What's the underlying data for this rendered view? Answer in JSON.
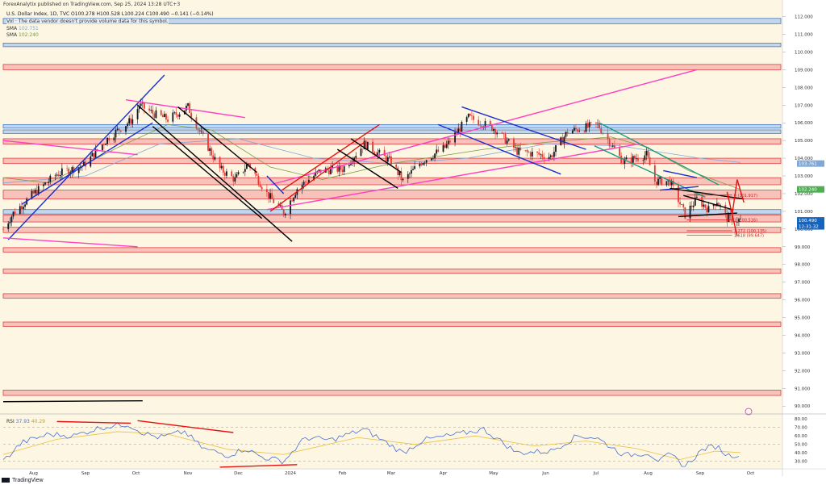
{
  "header": {
    "publisher": "ForexAnalytix published on TradingView.com, Sep 25, 2024 13:28 UTC+3",
    "symbol_line": "U.S. Dollar Index, 1D, TVC  O100.278  H100.528  L100.224  C100.490  −0.141 (−0.14%)",
    "volume_note": "Vol · The data vendor doesn't provide volume data for this symbol.",
    "sma1_label": "SMA",
    "sma1_value": "102.751",
    "sma2_label": "SMA",
    "sma2_value": "102.240"
  },
  "rsi_legend": {
    "label": "RSI",
    "value1": "37.93",
    "value2": "40.29"
  },
  "footer": {
    "brand": "TradingView"
  },
  "colors": {
    "background": "#fdf6e3",
    "candle_up": "#131722",
    "candle_down": "#e53935",
    "zone_red": "#f4b9b2",
    "zone_red_border": "#e04040",
    "zone_blue": "#b7d1ec",
    "zone_blue_border": "#4a78c0",
    "magenta": "#ff40c0",
    "blue_line": "#1a2fd0",
    "black_line": "#000000",
    "red_line": "#e81010",
    "teal_line": "#1a9a80",
    "sma_fast": "#7fa8d8",
    "sma_slow": "#7a9a40",
    "rsi_line": "#4a70d0",
    "rsi_signal": "#e8c040"
  },
  "chart_data": {
    "type": "candlestick",
    "title": "U.S. Dollar Index, 1D, TVC",
    "y_axis": {
      "ticks": [
        "112.000",
        "111.000",
        "110.000",
        "109.000",
        "108.000",
        "107.000",
        "106.000",
        "105.000",
        "104.000",
        "103.000",
        "102.000",
        "101.000",
        "100.000",
        "99.000",
        "98.000",
        "97.000",
        "96.000",
        "95.000",
        "94.000",
        "93.000",
        "92.000",
        "91.000",
        "90.000"
      ],
      "range": [
        89.6,
        112.3
      ]
    },
    "x_axis": {
      "ticks": [
        "Aug",
        "Sep",
        "Oct",
        "Nov",
        "Dec",
        "2024",
        "Feb",
        "Mar",
        "Apr",
        "May",
        "Jun",
        "Jul",
        "Aug",
        "Sep",
        "Oct"
      ]
    },
    "price_labels": [
      {
        "value": 103.7,
        "text": "103.761",
        "color": "#7fa8d8"
      },
      {
        "value": 102.24,
        "text": "102.240",
        "color": "#4caf50"
      },
      {
        "value": 100.49,
        "text": "100.490",
        "color": "#1565c0"
      },
      {
        "value": 100.15,
        "text": "12:31:32",
        "color": "#1565c0"
      }
    ],
    "fib_labels": [
      {
        "value": 101.917,
        "text": "0 (101.917)"
      },
      {
        "value": 100.516,
        "text": "1 (100.516)"
      },
      {
        "value": 99.9,
        "text": "1.272 (100.135)"
      },
      {
        "value": 99.647,
        "text": "1.618 (99.647)"
      }
    ],
    "close_path": [
      {
        "x": "2023-07-14",
        "y": 100.0
      },
      {
        "x": "2023-07-20",
        "y": 100.9
      },
      {
        "x": "2023-08-01",
        "y": 102.0
      },
      {
        "x": "2023-08-15",
        "y": 103.1
      },
      {
        "x": "2023-08-31",
        "y": 103.6
      },
      {
        "x": "2023-09-15",
        "y": 105.2
      },
      {
        "x": "2023-09-29",
        "y": 106.2
      },
      {
        "x": "2023-10-03",
        "y": 107.0
      },
      {
        "x": "2023-10-12",
        "y": 106.5
      },
      {
        "x": "2023-10-20",
        "y": 106.2
      },
      {
        "x": "2023-11-01",
        "y": 106.9
      },
      {
        "x": "2023-11-08",
        "y": 105.5
      },
      {
        "x": "2023-11-20",
        "y": 103.4
      },
      {
        "x": "2023-11-29",
        "y": 102.8
      },
      {
        "x": "2023-12-07",
        "y": 103.7
      },
      {
        "x": "2023-12-18",
        "y": 102.0
      },
      {
        "x": "2023-12-28",
        "y": 100.9
      },
      {
        "x": "2024-01-05",
        "y": 102.3
      },
      {
        "x": "2024-01-19",
        "y": 103.3
      },
      {
        "x": "2024-02-01",
        "y": 103.4
      },
      {
        "x": "2024-02-14",
        "y": 104.8
      },
      {
        "x": "2024-03-01",
        "y": 103.8
      },
      {
        "x": "2024-03-08",
        "y": 102.7
      },
      {
        "x": "2024-03-19",
        "y": 103.8
      },
      {
        "x": "2024-04-02",
        "y": 104.6
      },
      {
        "x": "2024-04-16",
        "y": 106.3
      },
      {
        "x": "2024-05-01",
        "y": 105.7
      },
      {
        "x": "2024-05-15",
        "y": 104.4
      },
      {
        "x": "2024-06-04",
        "y": 104.1
      },
      {
        "x": "2024-06-14",
        "y": 105.5
      },
      {
        "x": "2024-07-02",
        "y": 105.9
      },
      {
        "x": "2024-07-17",
        "y": 103.8
      },
      {
        "x": "2024-07-31",
        "y": 104.2
      },
      {
        "x": "2024-08-05",
        "y": 102.7
      },
      {
        "x": "2024-08-14",
        "y": 102.7
      },
      {
        "x": "2024-08-23",
        "y": 100.8
      },
      {
        "x": "2024-08-30",
        "y": 101.7
      },
      {
        "x": "2024-09-06",
        "y": 101.1
      },
      {
        "x": "2024-09-11",
        "y": 101.6
      },
      {
        "x": "2024-09-17",
        "y": 100.6
      },
      {
        "x": "2024-09-25",
        "y": 100.49
      }
    ],
    "sma_fast_path": [
      {
        "x": "2023-07-14",
        "y": 102.6
      },
      {
        "x": "2023-09-01",
        "y": 103.0
      },
      {
        "x": "2023-10-15",
        "y": 104.8
      },
      {
        "x": "2023-12-01",
        "y": 105.1
      },
      {
        "x": "2024-01-15",
        "y": 104.0
      },
      {
        "x": "2024-03-01",
        "y": 103.7
      },
      {
        "x": "2024-04-15",
        "y": 104.0
      },
      {
        "x": "2024-06-01",
        "y": 104.8
      },
      {
        "x": "2024-07-15",
        "y": 104.7
      },
      {
        "x": "2024-09-01",
        "y": 104.0
      },
      {
        "x": "2024-09-25",
        "y": 103.76
      }
    ],
    "sma_slow_path": [
      {
        "x": "2023-07-14",
        "y": 102.9
      },
      {
        "x": "2023-08-10",
        "y": 102.6
      },
      {
        "x": "2023-09-20",
        "y": 104.6
      },
      {
        "x": "2023-10-20",
        "y": 105.9
      },
      {
        "x": "2023-11-15",
        "y": 105.6
      },
      {
        "x": "2023-12-20",
        "y": 103.5
      },
      {
        "x": "2024-01-20",
        "y": 102.8
      },
      {
        "x": "2024-03-01",
        "y": 103.7
      },
      {
        "x": "2024-04-25",
        "y": 104.5
      },
      {
        "x": "2024-06-01",
        "y": 104.9
      },
      {
        "x": "2024-07-10",
        "y": 105.2
      },
      {
        "x": "2024-08-01",
        "y": 104.6
      },
      {
        "x": "2024-08-25",
        "y": 103.3
      },
      {
        "x": "2024-09-25",
        "y": 102.24
      }
    ],
    "zones": [
      {
        "color": "blue",
        "from": 111.6,
        "to": 111.9
      },
      {
        "color": "blue",
        "from": 110.3,
        "to": 110.5
      },
      {
        "color": "red",
        "from": 109.0,
        "to": 109.3
      },
      {
        "color": "blue",
        "from": 105.7,
        "to": 105.9
      },
      {
        "color": "blue",
        "from": 105.4,
        "to": 105.6
      },
      {
        "color": "red",
        "from": 104.8,
        "to": 105.1
      },
      {
        "color": "red",
        "from": 103.7,
        "to": 104.0
      },
      {
        "color": "red",
        "from": 102.5,
        "to": 102.9
      },
      {
        "color": "red",
        "from": 101.7,
        "to": 102.2
      },
      {
        "color": "blue",
        "from": 100.85,
        "to": 101.1
      },
      {
        "color": "red",
        "from": 100.4,
        "to": 100.8
      },
      {
        "color": "red",
        "from": 99.8,
        "to": 100.1
      },
      {
        "color": "red",
        "from": 98.7,
        "to": 98.95
      },
      {
        "color": "red",
        "from": 97.5,
        "to": 97.75
      },
      {
        "color": "red",
        "from": 96.1,
        "to": 96.35
      },
      {
        "color": "red",
        "from": 94.5,
        "to": 94.75
      },
      {
        "color": "red",
        "from": 90.6,
        "to": 90.9
      }
    ],
    "trendlines": [
      {
        "color": "blue",
        "from": {
          "x": "2023-07-17",
          "y": 99.4
        },
        "to": {
          "x": "2023-10-18",
          "y": 108.7
        }
      },
      {
        "color": "blue",
        "from": {
          "x": "2023-07-25",
          "y": 101.4
        },
        "to": {
          "x": "2023-10-11",
          "y": 106.0
        }
      },
      {
        "color": "magenta",
        "from": {
          "x": "2023-07-14",
          "y": 105.0
        },
        "to": {
          "x": "2023-10-02",
          "y": 104.2
        }
      },
      {
        "color": "magenta",
        "from": {
          "x": "2023-07-14",
          "y": 99.5
        },
        "to": {
          "x": "2023-10-02",
          "y": 99.0
        }
      },
      {
        "color": "magenta",
        "from": {
          "x": "2023-09-25",
          "y": 107.3
        },
        "to": {
          "x": "2023-12-05",
          "y": 106.3
        }
      },
      {
        "color": "black",
        "from": {
          "x": "2023-10-02",
          "y": 107.0
        },
        "to": {
          "x": "2024-01-02",
          "y": 99.3
        }
      },
      {
        "color": "black",
        "from": {
          "x": "2023-10-11",
          "y": 105.8
        },
        "to": {
          "x": "2023-12-15",
          "y": 100.6
        }
      },
      {
        "color": "black",
        "from": {
          "x": "2023-10-26",
          "y": 106.9
        },
        "to": {
          "x": "2023-12-12",
          "y": 103.2
        }
      },
      {
        "color": "magenta",
        "from": {
          "x": "2023-12-18",
          "y": 101.1
        },
        "to": {
          "x": "2024-07-26",
          "y": 104.8
        }
      },
      {
        "color": "magenta",
        "from": {
          "x": "2023-12-20",
          "y": 102.5
        },
        "to": {
          "x": "2024-08-30",
          "y": 109.0
        }
      },
      {
        "color": "blue",
        "from": {
          "x": "2023-12-18",
          "y": 103.0
        },
        "to": {
          "x": "2023-12-28",
          "y": 102.0
        }
      },
      {
        "color": "red",
        "from": {
          "x": "2023-12-20",
          "y": 101.0
        },
        "to": {
          "x": "2024-02-14",
          "y": 104.9
        }
      },
      {
        "color": "red",
        "from": {
          "x": "2023-12-27",
          "y": 102.2
        },
        "to": {
          "x": "2024-02-23",
          "y": 105.9
        }
      },
      {
        "color": "black",
        "from": {
          "x": "2024-01-29",
          "y": 104.5
        },
        "to": {
          "x": "2024-03-05",
          "y": 102.3
        }
      },
      {
        "color": "black",
        "from": {
          "x": "2024-02-06",
          "y": 105.1
        },
        "to": {
          "x": "2024-03-07",
          "y": 103.2
        }
      },
      {
        "color": "blue",
        "from": {
          "x": "2024-03-29",
          "y": 105.9
        },
        "to": {
          "x": "2024-06-10",
          "y": 103.1
        }
      },
      {
        "color": "blue",
        "from": {
          "x": "2024-04-12",
          "y": 106.9
        },
        "to": {
          "x": "2024-06-25",
          "y": 104.5
        }
      },
      {
        "color": "teal",
        "from": {
          "x": "2024-07-03",
          "y": 106.0
        },
        "to": {
          "x": "2024-09-12",
          "y": 102.5
        }
      },
      {
        "color": "teal",
        "from": {
          "x": "2024-06-30",
          "y": 104.7
        },
        "to": {
          "x": "2024-09-04",
          "y": 101.8
        }
      },
      {
        "color": "blue",
        "from": {
          "x": "2024-08-08",
          "y": 102.2
        },
        "to": {
          "x": "2024-08-31",
          "y": 102.4
        }
      },
      {
        "color": "blue",
        "from": {
          "x": "2024-08-10",
          "y": 103.3
        },
        "to": {
          "x": "2024-08-30",
          "y": 102.9
        }
      },
      {
        "color": "black",
        "from": {
          "x": "2024-08-14",
          "y": 102.3
        },
        "to": {
          "x": "2024-09-27",
          "y": 101.7
        }
      },
      {
        "color": "black",
        "from": {
          "x": "2024-08-19",
          "y": 100.7
        },
        "to": {
          "x": "2024-09-23",
          "y": 100.9
        }
      },
      {
        "color": "black",
        "from": {
          "x": "2024-08-22",
          "y": 101.9
        },
        "to": {
          "x": "2024-09-20",
          "y": 101.1
        }
      },
      {
        "color": "red",
        "from": {
          "x": "2024-09-20",
          "y": 100.8
        },
        "to": {
          "x": "2024-09-23",
          "y": 102.8
        }
      },
      {
        "color": "red",
        "from": {
          "x": "2024-09-23",
          "y": 102.8
        },
        "to": {
          "x": "2024-09-27",
          "y": 101.5
        }
      },
      {
        "color": "red",
        "from": {
          "x": "2024-09-17",
          "y": 102.1
        },
        "to": {
          "x": "2024-09-23",
          "y": 99.6
        }
      }
    ],
    "rsi": {
      "ticks": [
        "80.00",
        "70.00",
        "60.00",
        "50.00",
        "40.00",
        "30.00"
      ],
      "range": [
        22,
        85
      ],
      "series": [
        {
          "x": "2023-07-14",
          "y": 30
        },
        {
          "x": "2023-07-25",
          "y": 52
        },
        {
          "x": "2023-08-10",
          "y": 62
        },
        {
          "x": "2023-08-25",
          "y": 60
        },
        {
          "x": "2023-09-10",
          "y": 70
        },
        {
          "x": "2023-09-26",
          "y": 74
        },
        {
          "x": "2023-10-06",
          "y": 63
        },
        {
          "x": "2023-10-15",
          "y": 58
        },
        {
          "x": "2023-10-30",
          "y": 65
        },
        {
          "x": "2023-11-10",
          "y": 45
        },
        {
          "x": "2023-11-25",
          "y": 37
        },
        {
          "x": "2023-12-05",
          "y": 45
        },
        {
          "x": "2023-12-15",
          "y": 35
        },
        {
          "x": "2023-12-28",
          "y": 30
        },
        {
          "x": "2024-01-10",
          "y": 58
        },
        {
          "x": "2024-01-25",
          "y": 55
        },
        {
          "x": "2024-02-14",
          "y": 68
        },
        {
          "x": "2024-03-08",
          "y": 40
        },
        {
          "x": "2024-03-20",
          "y": 55
        },
        {
          "x": "2024-04-10",
          "y": 62
        },
        {
          "x": "2024-04-25",
          "y": 68
        },
        {
          "x": "2024-05-15",
          "y": 40
        },
        {
          "x": "2024-06-04",
          "y": 42
        },
        {
          "x": "2024-06-20",
          "y": 60
        },
        {
          "x": "2024-07-01",
          "y": 58
        },
        {
          "x": "2024-07-18",
          "y": 37
        },
        {
          "x": "2024-08-01",
          "y": 40
        },
        {
          "x": "2024-08-08",
          "y": 30
        },
        {
          "x": "2024-08-14",
          "y": 38
        },
        {
          "x": "2024-08-23",
          "y": 24
        },
        {
          "x": "2024-09-03",
          "y": 45
        },
        {
          "x": "2024-09-11",
          "y": 48
        },
        {
          "x": "2024-09-17",
          "y": 37
        },
        {
          "x": "2024-09-25",
          "y": 37.93
        }
      ],
      "signal": [
        {
          "x": "2023-07-14",
          "y": 38
        },
        {
          "x": "2023-08-15",
          "y": 56
        },
        {
          "x": "2023-09-20",
          "y": 65
        },
        {
          "x": "2023-10-20",
          "y": 62
        },
        {
          "x": "2023-11-25",
          "y": 44
        },
        {
          "x": "2023-12-28",
          "y": 38
        },
        {
          "x": "2024-02-10",
          "y": 58
        },
        {
          "x": "2024-03-15",
          "y": 50
        },
        {
          "x": "2024-04-20",
          "y": 60
        },
        {
          "x": "2024-05-25",
          "y": 48
        },
        {
          "x": "2024-06-25",
          "y": 54
        },
        {
          "x": "2024-07-25",
          "y": 45
        },
        {
          "x": "2024-08-20",
          "y": 32
        },
        {
          "x": "2024-09-10",
          "y": 42
        },
        {
          "x": "2024-09-25",
          "y": 40.29
        }
      ],
      "lines": [
        {
          "color": "red",
          "from": {
            "x": "2023-08-15",
            "y": 77
          },
          "to": {
            "x": "2023-09-28",
            "y": 75
          }
        },
        {
          "color": "red",
          "from": {
            "x": "2023-10-02",
            "y": 78
          },
          "to": {
            "x": "2023-11-28",
            "y": 64
          }
        },
        {
          "color": "red",
          "from": {
            "x": "2023-11-20",
            "y": 23
          },
          "to": {
            "x": "2024-01-05",
            "y": 26
          }
        },
        {
          "color": "black",
          "from": {
            "x": "2023-07-14",
            "y": 85
          },
          "to": {
            "x": "2023-10-05",
            "y": 88
          }
        }
      ]
    }
  }
}
